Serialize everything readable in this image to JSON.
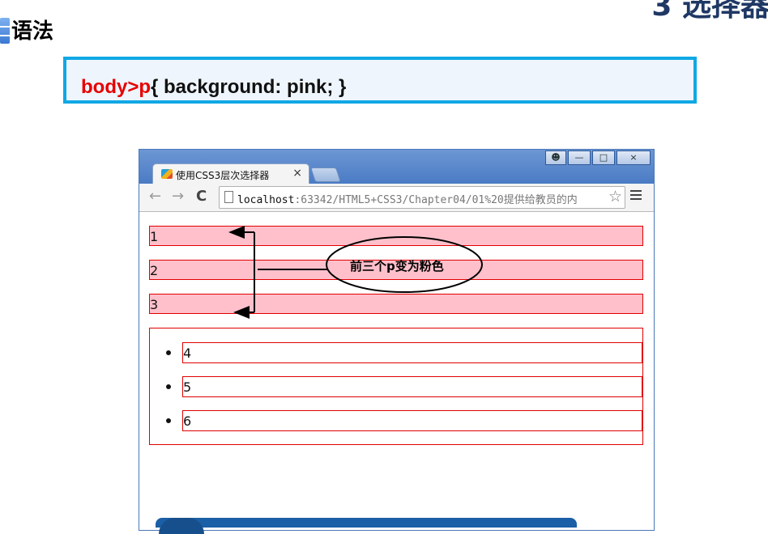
{
  "slide": {
    "corner_title": "3 选择器",
    "section_title": "语法",
    "code": {
      "selector": "body>p",
      "body": "{  background: pink;  }"
    },
    "callout": "前三个p变为粉色"
  },
  "browser": {
    "tab_title": "使用CSS3层次选择器",
    "tab_close": "×",
    "window_buttons": [
      "user",
      "minimize",
      "maximize",
      "close"
    ],
    "nav": {
      "back": "←",
      "forward": "→",
      "reload": "C"
    },
    "url_host": "localhost",
    "url_rest": ":63342/HTML5+CSS3/Chapter04/01%20提供给教员的内",
    "star": "☆"
  },
  "page": {
    "paragraphs": [
      "1",
      "2",
      "3"
    ],
    "list_items": [
      "4",
      "5",
      "6"
    ],
    "colors": {
      "paragraph_bg": "#ffc0cb",
      "border": "#e00000"
    }
  }
}
